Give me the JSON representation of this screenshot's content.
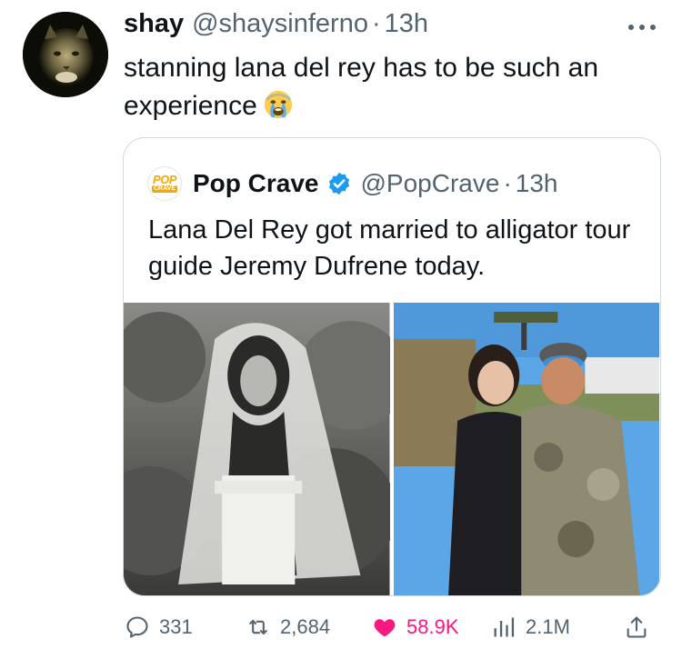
{
  "tweet": {
    "display_name": "shay",
    "handle": "@shaysinferno",
    "separator": "·",
    "time": "13h",
    "text": "stanning lana del rey has to be such an experience",
    "emoji": "loudly-crying-face"
  },
  "quote": {
    "avatar_top": "POP",
    "avatar_bottom": "CRAVE",
    "display_name": "Pop Crave",
    "handle": "@PopCrave",
    "separator": "·",
    "time": "13h",
    "text": "Lana Del Rey got married to alligator tour guide Jeremy Dufrene today.",
    "images": [
      "black-and-white bridal photo",
      "couple photo outdoors"
    ]
  },
  "actions": {
    "reply_count": "331",
    "retweet_count": "2,684",
    "like_count": "58.9K",
    "view_count": "2.1M"
  },
  "colors": {
    "text": "#0f1419",
    "secondary": "#536471",
    "like": "#f91880",
    "verified": "#1d9bf0",
    "border": "#cfd9de"
  },
  "icons": [
    "more-icon",
    "reply-icon",
    "retweet-icon",
    "heart-icon",
    "views-icon",
    "share-icon",
    "verified-icon",
    "crying-emoji-icon"
  ]
}
